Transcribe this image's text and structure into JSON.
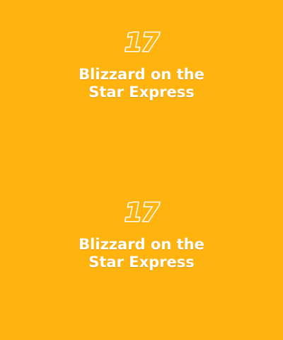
{
  "panels": [
    {
      "number": "17",
      "title_line1": "Blizzard on the",
      "title_line2": "Star Express"
    },
    {
      "number": "17",
      "title_line1": "Blizzard on the",
      "title_line2": "Star Express"
    }
  ],
  "colors": {
    "background": "#FFB30F",
    "text": "#ffffff"
  }
}
